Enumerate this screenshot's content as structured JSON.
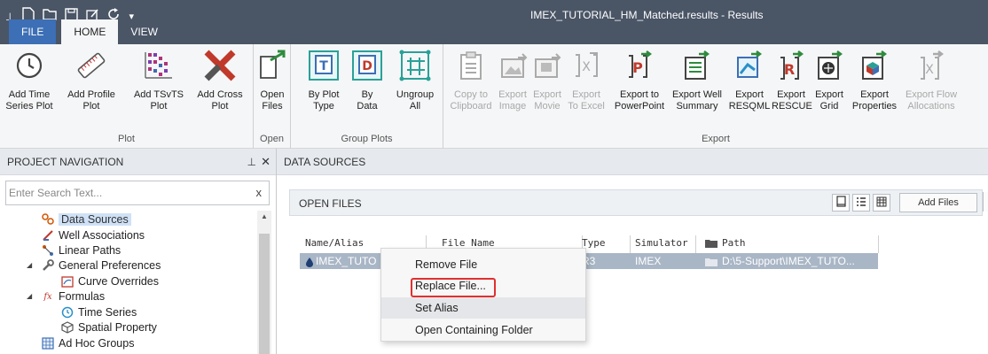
{
  "window": {
    "title": "IMEX_TUTORIAL_HM_Matched.results - Results"
  },
  "qat_icons": [
    "pin-icon",
    "new-icon",
    "open-folder-icon",
    "save-icon",
    "edit-icon",
    "refresh-icon",
    "dropdown-icon"
  ],
  "tabs": [
    {
      "label": "FILE",
      "active": false
    },
    {
      "label": "HOME",
      "active": true
    },
    {
      "label": "VIEW",
      "active": false
    }
  ],
  "ribbon": {
    "plot": {
      "label": "Plot",
      "buttons": [
        {
          "line1": "Add Time",
          "line2": "Series Plot",
          "icon": "clock-icon"
        },
        {
          "line1": "Add Profile",
          "line2": "Plot",
          "icon": "ruler-icon"
        },
        {
          "line1": "Add TSvTS",
          "line2": "Plot",
          "icon": "grid-plot-icon"
        },
        {
          "line1": "Add Cross",
          "line2": "Plot",
          "icon": "cross-plot-icon"
        }
      ]
    },
    "open": {
      "label": "Open",
      "line1": "Open",
      "line2": "Files",
      "icon": "open-files-icon"
    },
    "group_plots": {
      "label": "Group Plots",
      "buttons": [
        {
          "line1": "By Plot",
          "line2": "Type",
          "icon": "group-by-type-icon"
        },
        {
          "line1": "By",
          "line2": "Data",
          "icon": "group-by-data-icon"
        },
        {
          "line1": "Ungroup",
          "line2": "All",
          "icon": "ungroup-icon"
        }
      ]
    },
    "export": {
      "label": "Export",
      "buttons": [
        {
          "line1": "Copy to",
          "line2": "Clipboard",
          "icon": "clipboard-icon",
          "disabled": true
        },
        {
          "line1": "Export",
          "line2": "Image",
          "icon": "image-icon",
          "disabled": true
        },
        {
          "line1": "Export",
          "line2": "Movie",
          "icon": "movie-icon",
          "disabled": true
        },
        {
          "line1": "Export",
          "line2": "To Excel",
          "icon": "excel-icon",
          "disabled": true
        },
        {
          "line1": "Export to",
          "line2": "PowerPoint",
          "icon": "powerpoint-icon",
          "disabled": false
        },
        {
          "line1": "Export Well",
          "line2": "Summary",
          "icon": "well-summary-icon",
          "disabled": false
        },
        {
          "line1": "Export",
          "line2": "RESQML",
          "icon": "resqml-icon",
          "disabled": false
        },
        {
          "line1": "Export",
          "line2": "RESCUE",
          "icon": "rescue-icon",
          "disabled": false
        },
        {
          "line1": "Export",
          "line2": "Grid",
          "icon": "grid-icon",
          "disabled": false
        },
        {
          "line1": "Export",
          "line2": "Properties",
          "icon": "properties-icon",
          "disabled": false
        },
        {
          "line1": "Export Flow",
          "line2": "Allocations",
          "icon": "flow-icon",
          "disabled": true
        }
      ]
    }
  },
  "project_nav": {
    "title": "PROJECT NAVIGATION",
    "pin": "\u0004",
    "close": "✕",
    "search_placeholder": "Enter Search Text...",
    "search_clear": "x",
    "items": [
      {
        "label": "Data Sources",
        "icon": "data-sources-icon",
        "selected": true
      },
      {
        "label": "Well Associations",
        "icon": "well-icon"
      },
      {
        "label": "Linear Paths",
        "icon": "linear-path-icon"
      },
      {
        "label": "General Preferences",
        "icon": "wrench-icon",
        "expanded": true
      },
      {
        "label": "Curve Overrides",
        "icon": "curve-overrides-icon"
      },
      {
        "label": "Formulas",
        "icon": "formula-icon",
        "expanded": true
      },
      {
        "label": "Time Series",
        "icon": "clock-icon"
      },
      {
        "label": "Spatial Property",
        "icon": "cube-icon"
      },
      {
        "label": "Ad Hoc Groups",
        "icon": "group-icon"
      }
    ]
  },
  "data_sources": {
    "title": "DATA SOURCES",
    "open_files_label": "OPEN FILES",
    "add_files_label": "Add Files",
    "columns": [
      "Name/Alias",
      "File Name",
      "Type",
      "Simulator",
      "Path"
    ],
    "row": {
      "name": "IMEX_TUTO",
      "type": "R3",
      "simulator": "IMEX",
      "path": "D:\\5-Support\\IMEX_TUTO..."
    }
  },
  "context_menu": {
    "items": [
      "Remove File",
      "Replace File...",
      "Set Alias",
      "Open Containing Folder"
    ],
    "highlighted": "Replace File...",
    "hovered": "Set Alias"
  },
  "colors": {
    "titlebar": "#4a5566",
    "file_tab": "#3c6fb5",
    "selection_row": "#a9b6c6",
    "highlight_box": "#e03030"
  }
}
